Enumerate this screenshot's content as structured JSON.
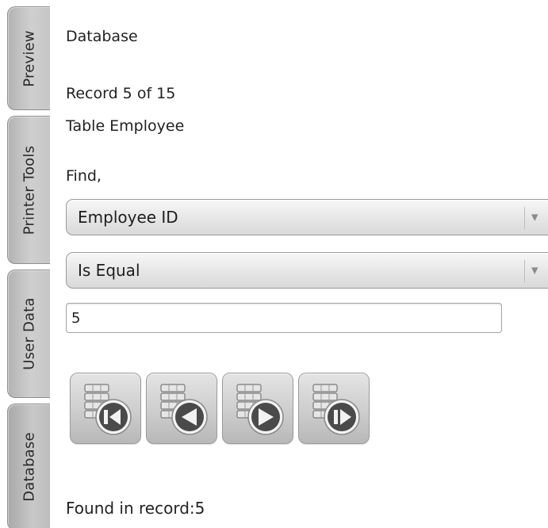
{
  "tabs": [
    {
      "label": "Preview"
    },
    {
      "label": "Printer Tools"
    },
    {
      "label": "User Data"
    },
    {
      "label": "Database",
      "active": true
    }
  ],
  "panel": {
    "heading": "Database",
    "record_status": "Record 5 of 15",
    "table_name": "Table Employee",
    "find_label": "Find,"
  },
  "find": {
    "field": {
      "selected": "Employee ID"
    },
    "operator": {
      "selected": "Is Equal"
    },
    "value": "5"
  },
  "navigation": {
    "buttons": [
      {
        "name": "first-record-button",
        "icon": "db-first-record-icon"
      },
      {
        "name": "previous-record-button",
        "icon": "db-previous-record-icon"
      },
      {
        "name": "next-record-button",
        "icon": "db-next-record-icon"
      },
      {
        "name": "last-record-button",
        "icon": "db-last-record-icon"
      }
    ]
  },
  "result": {
    "text": "Found in record:5"
  },
  "colors": {
    "tab_gray": "#c4c4c4",
    "button_gray": "#cdcdcd",
    "icon_dark": "#4a4a4a"
  }
}
